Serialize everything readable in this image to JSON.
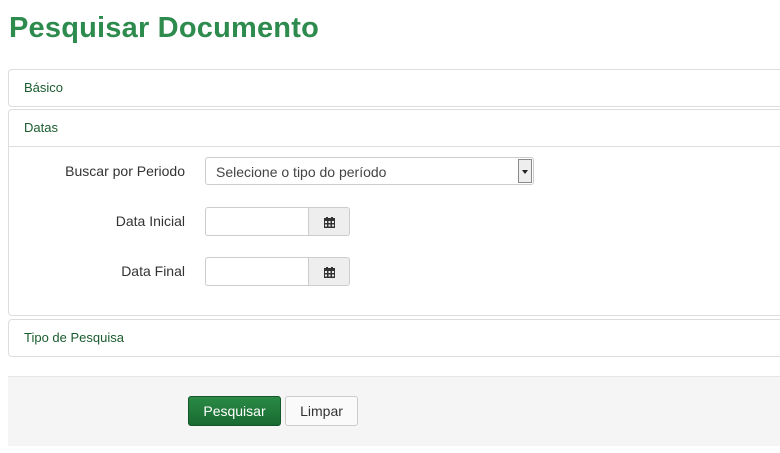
{
  "page": {
    "title": "Pesquisar Documento"
  },
  "panels": {
    "basico": {
      "label": "Básico"
    },
    "datas": {
      "label": "Datas"
    },
    "tipo": {
      "label": "Tipo de Pesquisa"
    }
  },
  "form": {
    "period": {
      "label": "Buscar por Periodo",
      "selected": "Selecione o tipo do período"
    },
    "start_date": {
      "label": "Data Inicial",
      "value": ""
    },
    "end_date": {
      "label": "Data Final",
      "value": ""
    }
  },
  "actions": {
    "search_label": "Pesquisar",
    "clear_label": "Limpar"
  },
  "icons": {
    "calendar": "calendar-icon",
    "dropdown": "chevron-down-icon"
  },
  "colors": {
    "title": "#2e8b4e",
    "panel_heading": "#1a5c2e",
    "primary_button": "#1f7a3c"
  }
}
